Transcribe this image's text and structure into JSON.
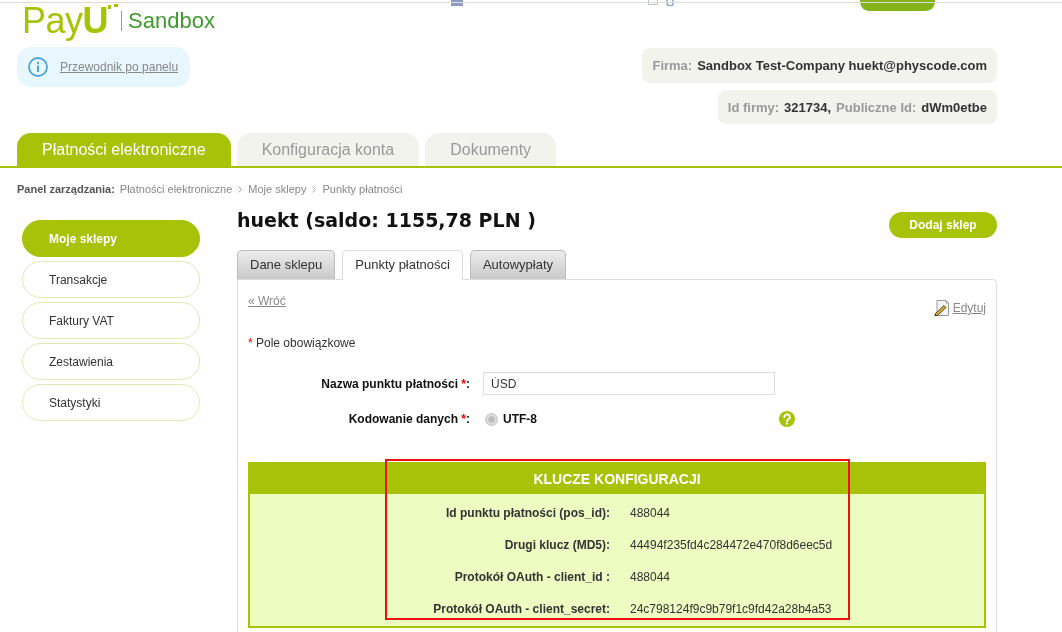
{
  "header": {
    "logo": {
      "brand": "Pay**U**",
      "product": "Sandbox"
    },
    "guide_link": "Przewodnik po panelu",
    "info_boxes": [
      {
        "fields": [
          {
            "label": "Firma:",
            "value": "Sandbox Test-Company huekt@physcode.com"
          }
        ]
      },
      {
        "fields": [
          {
            "label": "Id firmy:",
            "value": "321734,"
          },
          {
            "label": "Publiczne Id:",
            "value": "dWm0etbe"
          }
        ]
      }
    ]
  },
  "main_tabs": [
    {
      "label": "Płatności elektroniczne",
      "selected": true
    },
    {
      "label": "Konfiguracja konta",
      "selected": false
    },
    {
      "label": "Dokumenty",
      "selected": false
    }
  ],
  "breadcrumb": {
    "label": "Panel zarządzania:",
    "items": [
      "Płatności elektroniczne",
      "Moje sklepy",
      "Punkty płatności"
    ]
  },
  "sidebar": {
    "items": [
      {
        "label": "Moje sklepy",
        "selected": true
      },
      {
        "label": "Transakcje",
        "selected": false
      },
      {
        "label": "Faktury VAT",
        "selected": false
      },
      {
        "label": "Zestawienia",
        "selected": false
      },
      {
        "label": "Statystyki",
        "selected": false
      }
    ]
  },
  "content": {
    "title": "huekt (saldo: 1155,78 PLN )",
    "add_button": "Dodaj sklep",
    "tabs": [
      {
        "label": "Dane sklepu",
        "selected": false
      },
      {
        "label": "Punkty płatności",
        "selected": true
      },
      {
        "label": "Autowypłaty",
        "selected": false
      }
    ],
    "back_link": "« Wróć",
    "edit_link": "Edytuj",
    "required_note": {
      "mark": "*",
      "text": "Pole obowiązkowe"
    },
    "form": {
      "fields": [
        {
          "kind": "text",
          "label": "Nazwa punktu płatności",
          "required_mark": "*",
          "label_end": ":",
          "value": "ÙSD"
        },
        {
          "kind": "radio",
          "label": "Kodowanie danych",
          "required_mark": "*",
          "label_end": ":",
          "options": [
            {
              "label": "UTF-8",
              "selected": true,
              "disabled": true
            }
          ],
          "help": true
        }
      ]
    },
    "keys_panel": {
      "title": "KLUCZE KONFIGURACJI",
      "highlighted": true,
      "rows": [
        {
          "label": "Id punktu płatności (pos_id):",
          "value": "488044"
        },
        {
          "label": "Drugi klucz (MD5):",
          "value": "44494f235fd4c284472e470f8d6eec5d"
        },
        {
          "label": "Protokół OAuth - client_id :",
          "value": "488044"
        },
        {
          "label": "Protokół OAuth - client_secret:",
          "value": "24c798124f9c9b79f1c9fd42a28b4a53"
        }
      ]
    }
  }
}
